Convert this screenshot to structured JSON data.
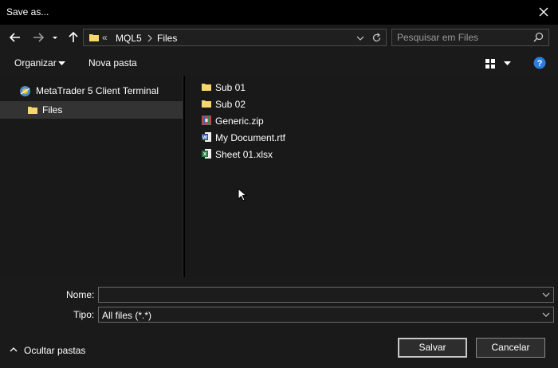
{
  "window": {
    "title": "Save as..."
  },
  "address": {
    "overflow": "«",
    "crumbs": [
      "MQL5",
      "Files"
    ]
  },
  "search": {
    "placeholder": "Pesquisar em Files"
  },
  "toolbar": {
    "organize_label": "Organizar",
    "new_folder_label": "Nova pasta"
  },
  "tree": [
    {
      "label": "MetaTrader 5 Client Terminal",
      "icon": "metatrader-icon",
      "selected": false
    },
    {
      "label": "Files",
      "icon": "folder-icon",
      "selected": true
    }
  ],
  "files": [
    {
      "name": "Sub 01",
      "icon": "folder-icon"
    },
    {
      "name": "Sub 02",
      "icon": "folder-icon"
    },
    {
      "name": "Generic.zip",
      "icon": "zip-archive-icon"
    },
    {
      "name": "My Document.rtf",
      "icon": "word-document-icon"
    },
    {
      "name": "Sheet 01.xlsx",
      "icon": "excel-sheet-icon"
    }
  ],
  "form": {
    "name_label": "Nome:",
    "name_value": "",
    "type_label": "Tipo:",
    "type_value": "All files (*.*)"
  },
  "footer": {
    "hide_folders_label": "Ocultar pastas",
    "save_label": "Salvar",
    "cancel_label": "Cancelar"
  },
  "colors": {
    "folder": "#f6d76b",
    "accent_help": "#2a7de1",
    "excel": "#1f7a3f",
    "word": "#2b579a"
  }
}
